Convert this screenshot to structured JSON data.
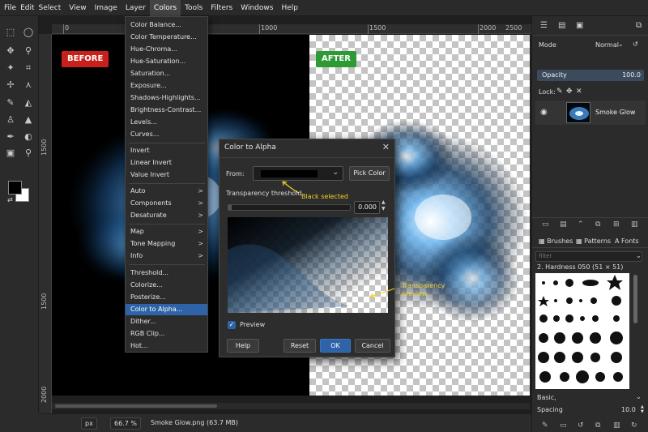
{
  "menubar": {
    "items": [
      "File",
      "Edit",
      "Select",
      "View",
      "Image",
      "Layer",
      "Colors",
      "Tools",
      "Filters",
      "Windows",
      "Help"
    ],
    "active": "Colors"
  },
  "colors_menu": {
    "items": [
      {
        "label": "Color Balance..."
      },
      {
        "label": "Color Temperature..."
      },
      {
        "label": "Hue-Chroma..."
      },
      {
        "label": "Hue-Saturation..."
      },
      {
        "label": "Saturation..."
      },
      {
        "label": "Exposure..."
      },
      {
        "label": "Shadows-Highlights..."
      },
      {
        "label": "Brightness-Contrast..."
      },
      {
        "label": "Levels..."
      },
      {
        "label": "Curves..."
      },
      {
        "label": "Invert"
      },
      {
        "label": "Linear Invert"
      },
      {
        "label": "Value Invert"
      },
      {
        "label": "Auto",
        "submenu": ">"
      },
      {
        "label": "Components",
        "submenu": ">"
      },
      {
        "label": "Desaturate",
        "submenu": ">"
      },
      {
        "label": "Map",
        "submenu": ">"
      },
      {
        "label": "Tone Mapping",
        "submenu": ">"
      },
      {
        "label": "Info",
        "submenu": ">"
      },
      {
        "label": "Threshold..."
      },
      {
        "label": "Colorize..."
      },
      {
        "label": "Posterize..."
      },
      {
        "label": "Color to Alpha..."
      },
      {
        "label": "Dither..."
      },
      {
        "label": "RGB Clip..."
      },
      {
        "label": "Hot..."
      }
    ],
    "selected": "Color to Alpha..."
  },
  "canvas": {
    "before_label": "BEFORE",
    "after_label": "AFTER",
    "ruler_top": [
      "500",
      "1000",
      "1500",
      "2000",
      "2500"
    ],
    "ruler_left": [
      "1500",
      "1500",
      "2000"
    ],
    "before_color": "#c8201a",
    "after_color": "#2d9a34"
  },
  "dialog": {
    "title": "Color to Alpha",
    "close": "✕",
    "from_label": "From:",
    "from_color": "#000000",
    "pick_color": "Pick Color",
    "annotation_black": "Black selected",
    "threshold_label": "Transparency threshold",
    "threshold_value": "0.000",
    "preview_label": "Preview",
    "preview_checked": true,
    "annotation_preview": "Transparency preview",
    "buttons": {
      "help": "Help",
      "reset": "Reset",
      "ok": "OK",
      "cancel": "Cancel"
    }
  },
  "layers": {
    "mode_label": "Mode",
    "mode_value": "Normal",
    "opacity_label": "Opacity",
    "opacity_value": "100.0",
    "lock_label": "Lock:",
    "layer_name": "Smoke Glow"
  },
  "brushes": {
    "tabs": [
      "Brushes",
      "Patterns",
      "Fonts"
    ],
    "filter_placeholder": "filter",
    "selected_brush": "2. Hardness 050 (51 × 51)",
    "preset": "Basic,",
    "spacing_label": "Spacing",
    "spacing_value": "10.0"
  },
  "statusbar": {
    "unit": "px",
    "zoom": "66.7 %",
    "file_info": "Smoke Glow.png (63.7 MB)"
  },
  "toolbox": {
    "fg_color": "#000000",
    "bg_color": "#ffffff"
  }
}
